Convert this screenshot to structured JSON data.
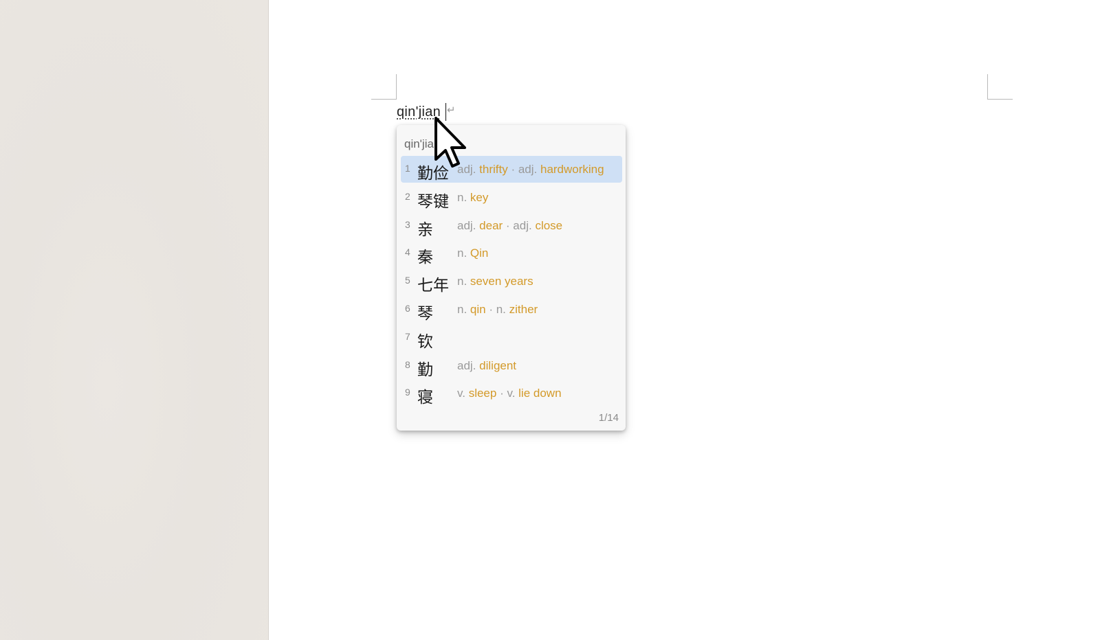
{
  "document": {
    "typed_text": "qin'jian",
    "paragraph_mark": "↵"
  },
  "ime": {
    "composition": "qin'jia",
    "page_counter": "1/14",
    "selected_index": 1,
    "candidates": [
      {
        "num": "1",
        "word": "勤俭",
        "defs": [
          {
            "pos": "adj.",
            "gloss": "thrifty"
          },
          {
            "pos": "adj.",
            "gloss": "hardworking"
          }
        ]
      },
      {
        "num": "2",
        "word": "琴键",
        "defs": [
          {
            "pos": "n.",
            "gloss": "key"
          }
        ]
      },
      {
        "num": "3",
        "word": "亲",
        "defs": [
          {
            "pos": "adj.",
            "gloss": "dear"
          },
          {
            "pos": "adj.",
            "gloss": "close"
          }
        ]
      },
      {
        "num": "4",
        "word": "秦",
        "defs": [
          {
            "pos": "n.",
            "gloss": "Qin"
          }
        ]
      },
      {
        "num": "5",
        "word": "七年",
        "defs": [
          {
            "pos": "n.",
            "gloss": "seven years"
          }
        ]
      },
      {
        "num": "6",
        "word": "琴",
        "defs": [
          {
            "pos": "n.",
            "gloss": "qin"
          },
          {
            "pos": "n.",
            "gloss": "zither"
          }
        ]
      },
      {
        "num": "7",
        "word": "钦",
        "defs": []
      },
      {
        "num": "8",
        "word": "勤",
        "defs": [
          {
            "pos": "adj.",
            "gloss": "diligent"
          }
        ]
      },
      {
        "num": "9",
        "word": "寝",
        "defs": [
          {
            "pos": "v.",
            "gloss": "sleep"
          },
          {
            "pos": "v.",
            "gloss": "lie down"
          }
        ]
      }
    ]
  },
  "icons": {
    "cursor": "mouse-pointer-arrow-icon",
    "paragraph_mark": "paragraph-return-icon"
  },
  "colors": {
    "selected_bg": "#cfe0f5",
    "gloss": "#d39a2a",
    "pos": "#9a9a9a",
    "popup_bg": "#f7f7f7",
    "sidebar_bg": "#e8e4df"
  }
}
